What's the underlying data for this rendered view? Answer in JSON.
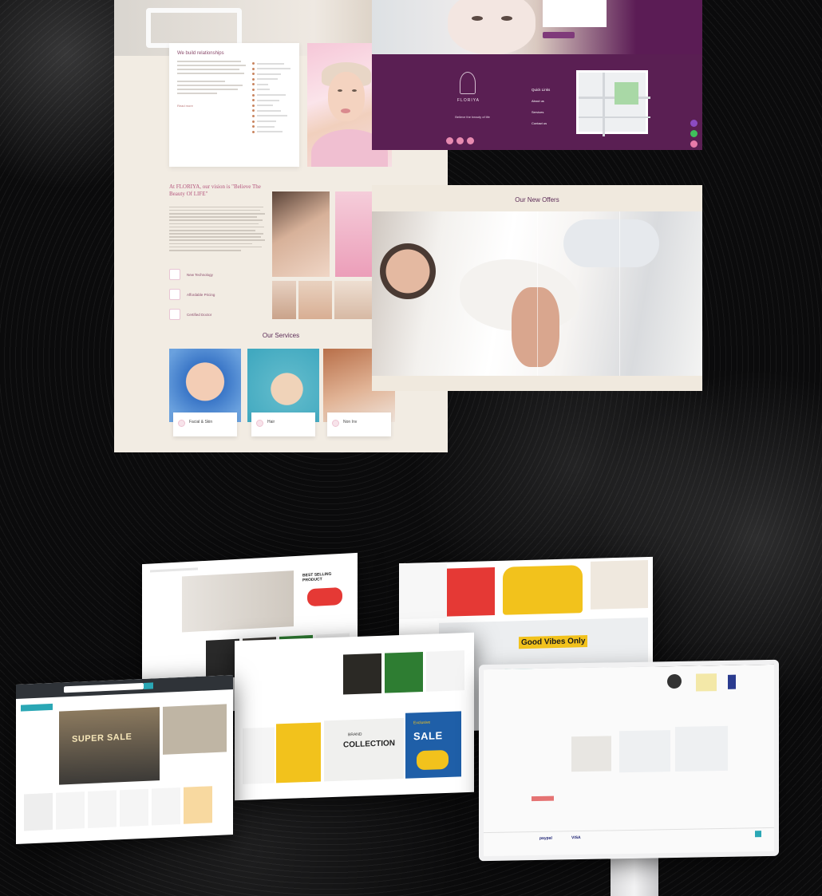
{
  "beauty_site": {
    "card_title": "We build relationships",
    "read_more": "Read more",
    "about_title": "At FLORIYA, our vision is \"Believe The Beauty Of LIFE\"",
    "features": [
      "New Technology",
      "Affordable Pricing",
      "Certified Doctor"
    ],
    "services_title": "Our Services",
    "services": [
      "Facial & Skin",
      "Hair",
      "Non Inv"
    ]
  },
  "purple_site": {
    "brand": "FLORIYA",
    "tagline": "Believe the beauty of life",
    "quick_links_title": "Quick Links",
    "quick_links": [
      "About us",
      "Services",
      "Contact us"
    ]
  },
  "offers_site": {
    "title": "Our New Offers"
  },
  "furniture_sites": {
    "a_badge": "BEST SELLING PRODUCT",
    "b_badge": "Good Vibes Only",
    "c_collection": "COLLECTION",
    "c_brand": "BRAND",
    "c_sale": "SALE",
    "c_sale_small": "Exclusive",
    "d_hero": "SUPER SALE",
    "payment_labels": [
      "VISA",
      "paypal"
    ]
  },
  "colors": {
    "purple": "#5a1f53",
    "cream": "#f2ece3",
    "accent_pink": "#b4557d",
    "furniture_blue": "#1f5fa8",
    "furniture_yellow": "#f2c21c"
  }
}
